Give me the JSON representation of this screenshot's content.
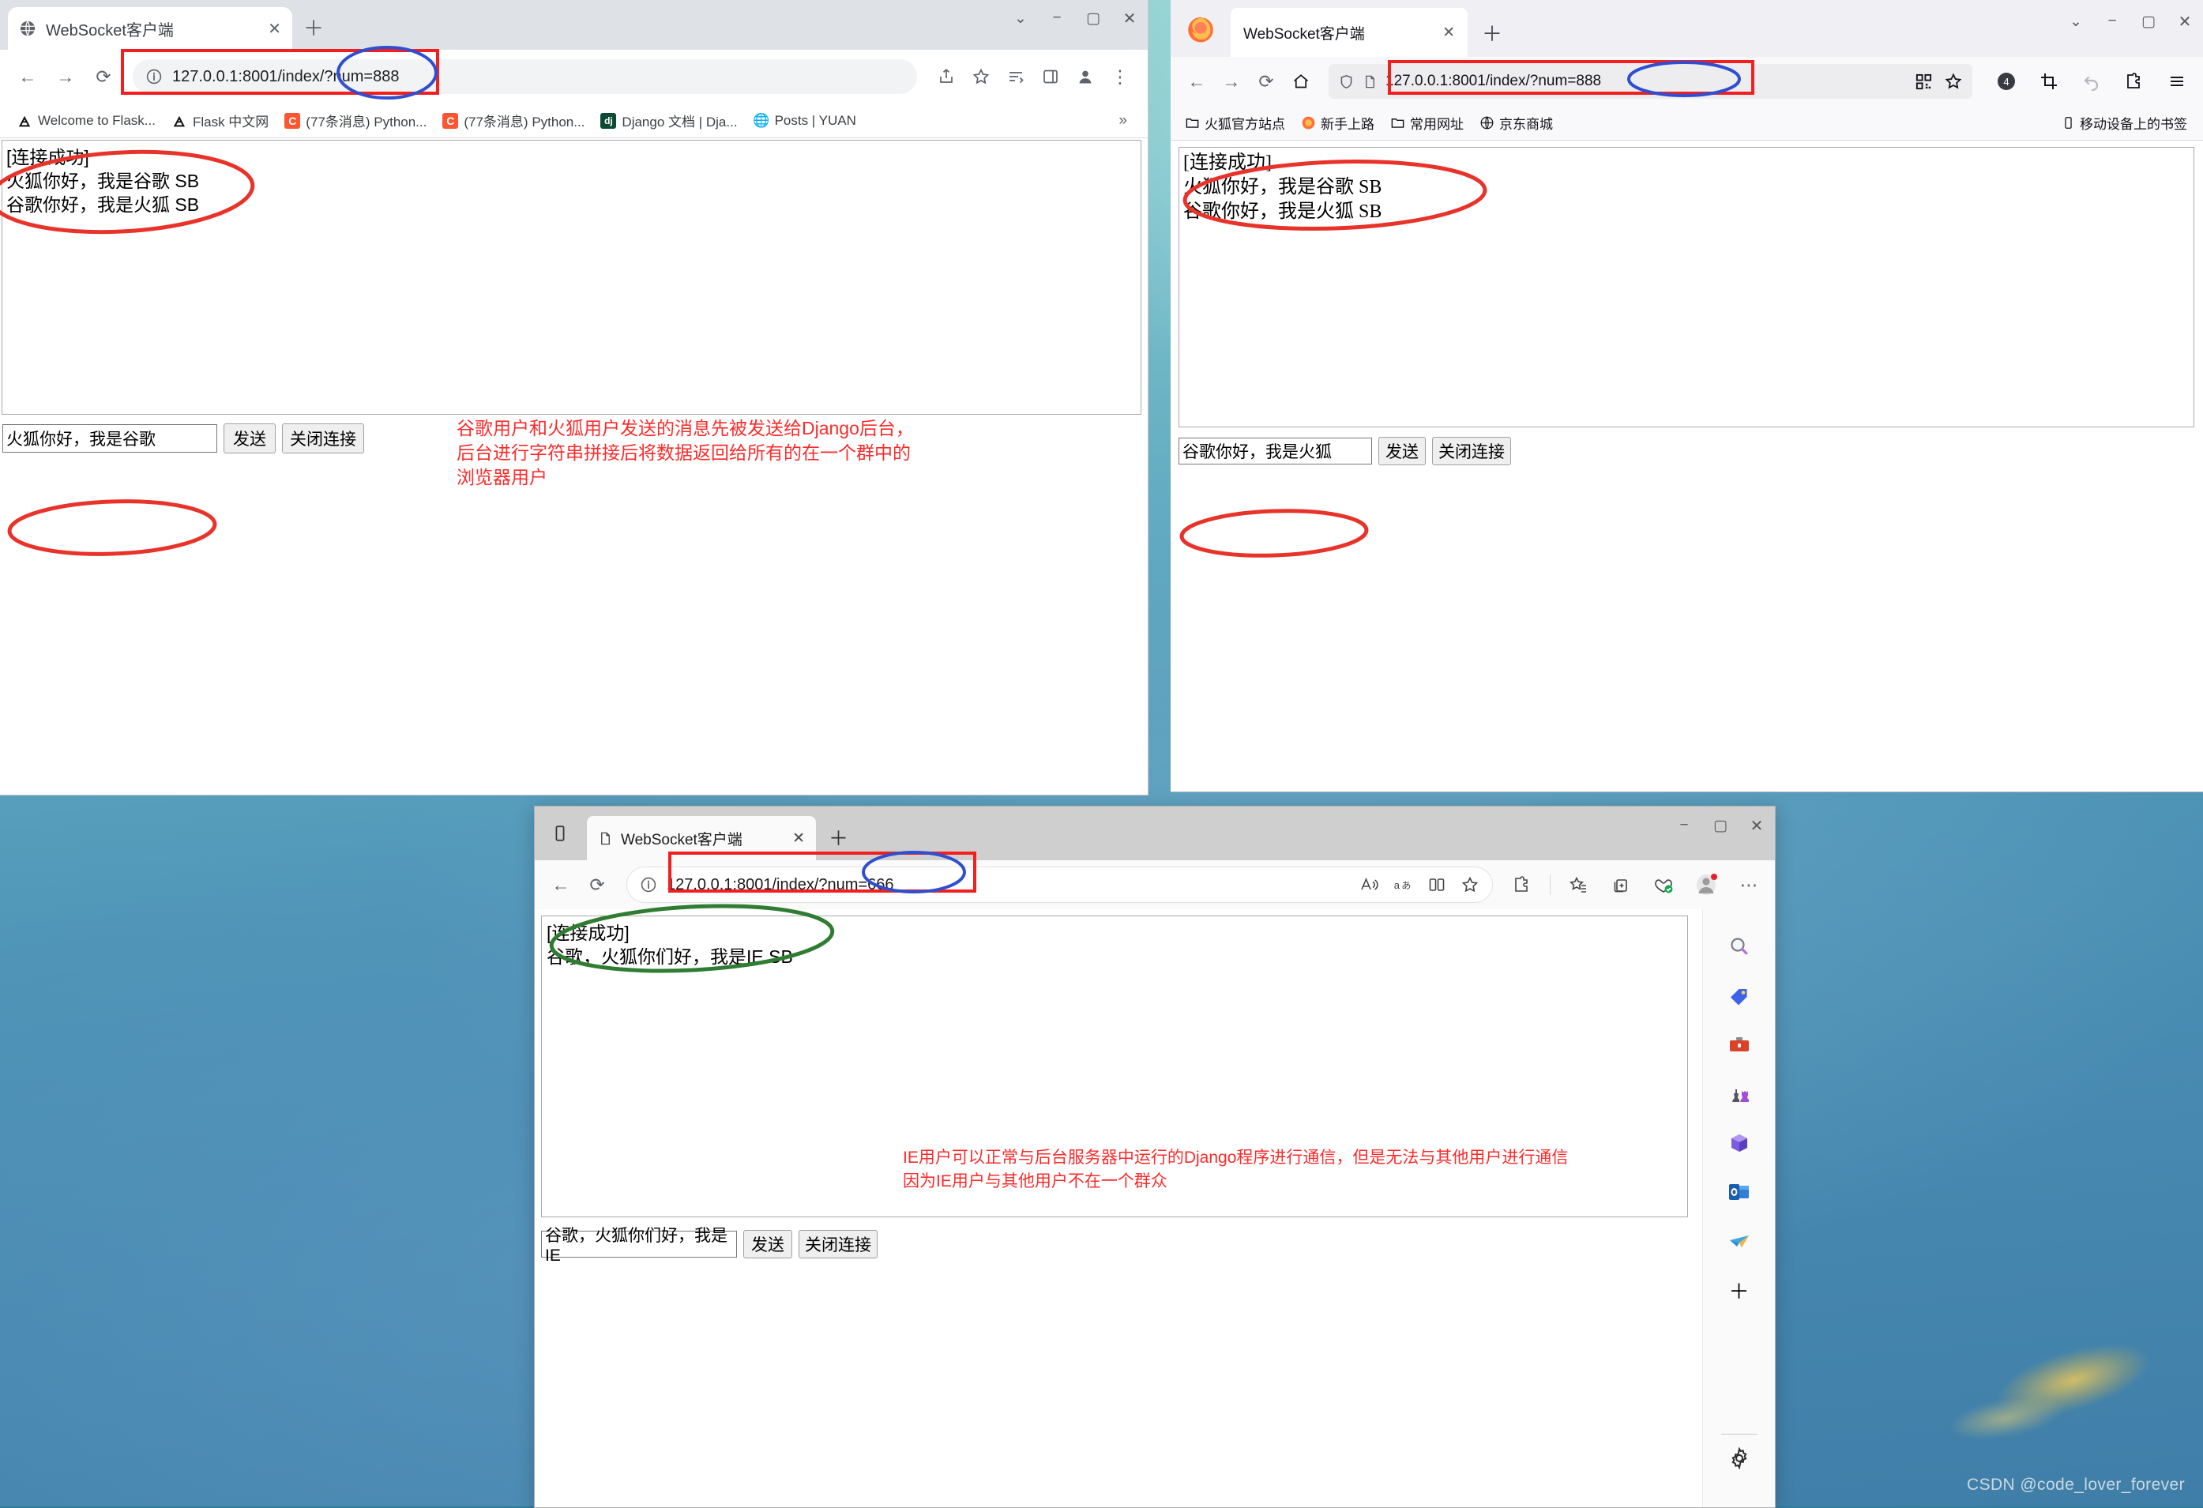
{
  "desktop": {
    "watermark": "CSDN @code_lover_forever"
  },
  "app": {
    "connected_line": "[连接成功]",
    "send_label": "发送",
    "close_label": "关闭连接"
  },
  "chrome": {
    "tab_title": "WebSocket客户端",
    "url_prefix": "127.0.0.1:8001/index/",
    "url_query": "?num=888",
    "bookmarks": [
      {
        "label": "Welcome to Flask...",
        "icon": "flask-icon"
      },
      {
        "label": "Flask 中文网",
        "icon": "flask-icon"
      },
      {
        "label": "(77条消息) Python...",
        "icon": "csdn-icon"
      },
      {
        "label": "(77条消息) Python...",
        "icon": "csdn-icon"
      },
      {
        "label": "Django 文档 | Dja...",
        "icon": "django-icon"
      },
      {
        "label": "Posts | YUAN",
        "icon": "globe-icon"
      }
    ],
    "overflow_label": "»",
    "messages": [
      "[连接成功]",
      "火狐你好，我是谷歌 SB",
      "谷歌你好，我是火狐 SB"
    ],
    "input_value": "火狐你好，我是谷歌",
    "annotation": "谷歌用户和火狐用户发送的消息先被发送给Django后台，\n后台进行字符串拼接后将数据返回给所有的在一个群中的\n浏览器用户"
  },
  "firefox": {
    "tab_title": "WebSocket客户端",
    "url_prefix": "127.0.0.1:8001/index/",
    "url_query": "?num=888",
    "bookmarks": [
      {
        "label": "火狐官方站点",
        "icon": "folder-icon"
      },
      {
        "label": "新手上路",
        "icon": "firefox-icon"
      },
      {
        "label": "常用网址",
        "icon": "folder-icon"
      },
      {
        "label": "京东商城",
        "icon": "globe-icon"
      }
    ],
    "mobile_bookmarks_label": "移动设备上的书签",
    "extension_badge": "4",
    "messages": [
      "[连接成功]",
      "火狐你好，我是谷歌 SB",
      "谷歌你好，我是火狐 SB"
    ],
    "input_value": "谷歌你好，我是火狐"
  },
  "edge": {
    "tab_title": "WebSocket客户端",
    "url_prefix": "127.0.0.1:8001/index/",
    "url_query": "?num=666",
    "messages": [
      "[连接成功]",
      "谷歌，火狐你们好，我是IE SB"
    ],
    "input_value": "谷歌，火狐你们好，我是IE",
    "annotation": "IE用户可以正常与后台服务器中运行的Django程序进行通信，但是无法与其他用户进行通信\n因为IE用户与其他用户不在一个群众",
    "sidebar_icons": [
      "search-icon",
      "shopping-tag-icon",
      "tools-icon",
      "games-icon",
      "office-icon",
      "outlook-icon",
      "telegram-icon",
      "add-icon"
    ],
    "settings_icon": "gear-icon"
  },
  "colors": {
    "annotation_red": "#fc2b2b",
    "highlight_rect": "#f21f1f",
    "highlight_ellipse_red": "#e8332a",
    "highlight_ellipse_blue": "#2f4fd0",
    "highlight_ellipse_green": "#2f7d32"
  }
}
